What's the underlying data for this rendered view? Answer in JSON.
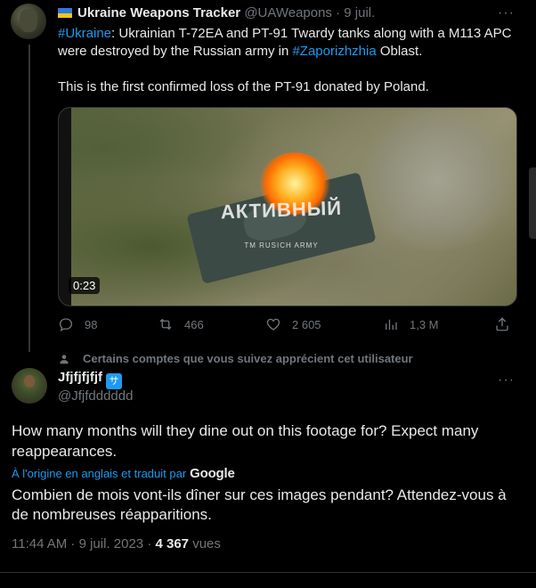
{
  "tweet": {
    "author_name": "Ukraine Weapons Tracker",
    "handle": "@UAWeapons",
    "separator": "·",
    "date": "9 juil.",
    "more": "···",
    "text": {
      "tag_ukraine": "#Ukraine",
      "part1": ": Ukrainian T-72EA and PT-91 Twardy tanks along with a M113 APC were destroyed by the Russian army in ",
      "tag_region": "#Zaporizhzhia",
      "part2": " Oblast.",
      "line2": "This is the first confirmed loss of the PT-91 donated by Poland."
    },
    "media": {
      "watermark": "АКТИВНЫЙ",
      "watermark_sub": "ТМ RUSICH ARMY",
      "duration": "0:23"
    },
    "actions": {
      "replies": "98",
      "retweets": "466",
      "likes": "2 605",
      "views": "1,3 M"
    }
  },
  "social_context": "Certains comptes que vous suivez apprécient cet utilisateur",
  "reply": {
    "author_name": "Jfjfjfjfjf",
    "handle": "@Jfjfdddddd",
    "verified_badge": "サ",
    "more": "···",
    "text": "How many months will they dine out on this footage for? Expect many reappearances.",
    "translation_note": "À l'origine en anglais et traduit par",
    "translation_provider": "Google",
    "translated_text": "Combien de mois vont-ils dîner sur ces images pendant? Attendez-vous à de nombreuses réapparitions.",
    "time": "11:44 AM · 9 juil. 2023 · ",
    "views_count": "4 367",
    "views_label": " vues"
  },
  "colors": {
    "background": "#000000",
    "text": "#e7e9ea",
    "muted": "#71767b",
    "link": "#1d9bf0"
  }
}
